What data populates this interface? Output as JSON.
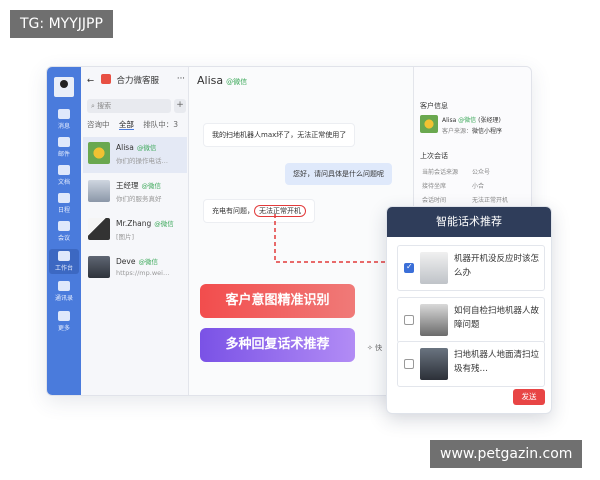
{
  "watermarks": {
    "top": "TG: MYYJJPP",
    "bottom": "www.petgazin.com"
  },
  "rail": {
    "items": [
      {
        "label": "消息",
        "icon": "chat-bubble-icon"
      },
      {
        "label": "邮件",
        "icon": "mail-icon"
      },
      {
        "label": "文档",
        "icon": "document-icon"
      },
      {
        "label": "日程",
        "icon": "calendar-icon"
      },
      {
        "label": "会议",
        "icon": "meeting-icon"
      },
      {
        "label": "工作台",
        "icon": "apps-grid-icon"
      },
      {
        "label": "通讯录",
        "icon": "contacts-icon"
      },
      {
        "label": "更多",
        "icon": "more-icon"
      }
    ]
  },
  "conversations": {
    "title": "合力微客服",
    "back": "←",
    "more": "···",
    "search_placeholder": "搜索",
    "add": "+",
    "filters": [
      "咨询中",
      "全部",
      "排队中：3"
    ],
    "items": [
      {
        "name": "Alisa",
        "tag": "@微信",
        "preview": "你们的操作电话…"
      },
      {
        "name": "王经理",
        "tag": "@微信",
        "preview": "你们的服务真好"
      },
      {
        "name": "Mr.Zhang",
        "tag": "@微信",
        "preview": "[图片]"
      },
      {
        "name": "Deve",
        "tag": "@微信",
        "preview": "https://mp.wei…"
      }
    ]
  },
  "chat": {
    "title": "Alisa",
    "tag": "@微信",
    "messages": [
      {
        "dir": "in",
        "text": "我的扫地机器人max坏了，无法正常使用了"
      },
      {
        "dir": "out",
        "text": "您好，请问具体是什么问题呢"
      },
      {
        "dir": "in",
        "text": "充电有问题，",
        "highlight": "无法正常开机"
      }
    ],
    "send_hint": "快"
  },
  "features": {
    "intent": "客户意图精准识别",
    "reply": "多种回复话术推荐"
  },
  "info": {
    "customer_section": "客户信息",
    "customer_name": "Alisa",
    "customer_tag": "@微信",
    "customer_manager": "(张经理)",
    "customer_source_label": "客户来源：",
    "customer_source": "微信小程序",
    "last_section": "上次会话",
    "rows": [
      [
        "当前会话来源",
        "公众号"
      ],
      [
        "接待坐席",
        "小合"
      ],
      [
        "会话时间",
        "无法正常开机"
      ]
    ]
  },
  "recommend": {
    "title": "智能话术推荐",
    "items": [
      {
        "text": "机器开机没反应时该怎么办",
        "checked": true
      },
      {
        "text": "如何自检扫地机器人故障问题",
        "checked": false
      },
      {
        "text": "扫地机器人地面清扫垃圾有残…",
        "checked": false
      }
    ],
    "send": "发送"
  },
  "colors": {
    "brand": "#4a7bdc",
    "accent_red": "#e84545",
    "wechat": "#3aa858",
    "panel_header": "#2f3d5a"
  }
}
